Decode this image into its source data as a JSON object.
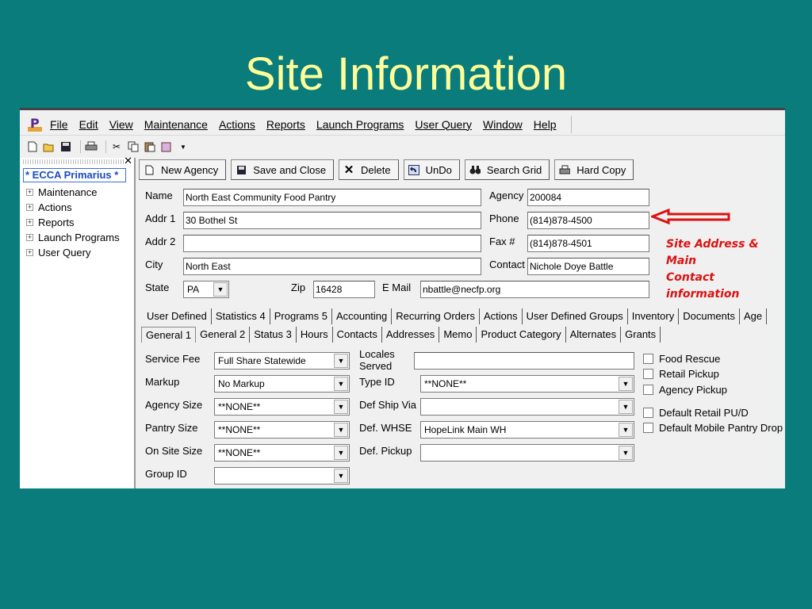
{
  "slide": {
    "title": "Site Information"
  },
  "menubar": {
    "items": [
      "File",
      "Edit",
      "View",
      "Maintenance",
      "Actions",
      "Reports",
      "Launch Programs",
      "User Query",
      "Window",
      "Help"
    ]
  },
  "sidebar": {
    "selected": "* ECCA Primarius *",
    "close_glyph": "✕",
    "items": [
      "Maintenance",
      "Actions",
      "Reports",
      "Launch Programs",
      "User Query"
    ]
  },
  "buttons": {
    "new_agency": "New Agency",
    "save_and_close": "Save and Close",
    "delete": "Delete",
    "undo": "UnDo",
    "search_grid": "Search Grid",
    "hard_copy": "Hard Copy"
  },
  "form": {
    "name_label": "Name",
    "name_value": "North East Community Food Pantry",
    "addr1_label": "Addr 1",
    "addr1_value": "30 Bothel St",
    "addr2_label": "Addr 2",
    "addr2_value": "",
    "city_label": "City",
    "city_value": "North East",
    "state_label": "State",
    "state_value": "PA",
    "zip_label": "Zip",
    "zip_value": "16428",
    "email_label": "E Mail",
    "email_value": "nbattle@necfp.org",
    "agency_label": "Agency",
    "agency_value": "200084",
    "phone_label": "Phone",
    "phone_value": "(814)878-4500",
    "fax_label": "Fax #",
    "fax_value": "(814)878-4501",
    "contact_label": "Contact",
    "contact_value": "Nichole Doye Battle"
  },
  "tabs_row1": [
    "User Defined",
    "Statistics 4",
    "Programs 5",
    "Accounting",
    "Recurring Orders",
    "Actions",
    "User Defined Groups",
    "Inventory",
    "Documents",
    "Age"
  ],
  "tabs_row2": [
    "General 1",
    "General 2",
    "Status 3",
    "Hours",
    "Contacts",
    "Addresses",
    "Memo",
    "Product Category",
    "Alternates",
    "Grants"
  ],
  "general": {
    "service_fee_label": "Service Fee",
    "service_fee_value": "Full Share Statewide",
    "markup_label": "Markup",
    "markup_value": "No Markup",
    "agency_size_label": "Agency Size",
    "agency_size_value": "**NONE**",
    "pantry_size_label": "Pantry Size",
    "pantry_size_value": "**NONE**",
    "on_site_size_label": "On Site Size",
    "on_site_size_value": "**NONE**",
    "group_id_label": "Group ID",
    "group_id_value": "",
    "locales_label_1": "Locales",
    "locales_label_2": "Served",
    "locales_value": "",
    "type_id_label": "Type ID",
    "type_id_value": "**NONE**",
    "def_ship_via_label": "Def Ship Via",
    "def_ship_via_value": "",
    "def_whse_label": "Def. WHSE",
    "def_whse_value": "HopeLink Main WH",
    "def_pickup_label": "Def. Pickup",
    "def_pickup_value": ""
  },
  "checkboxes": {
    "food_rescue": "Food Rescue",
    "retail_pickup": "Retail Pickup",
    "agency_pickup": "Agency Pickup",
    "default_retail": "Default Retail PU/D",
    "default_mobile": "Default Mobile Pantry Drop"
  },
  "annotation": {
    "line1": "Site Address & Main",
    "line2": "Contact information",
    "color": "#dd1111"
  }
}
